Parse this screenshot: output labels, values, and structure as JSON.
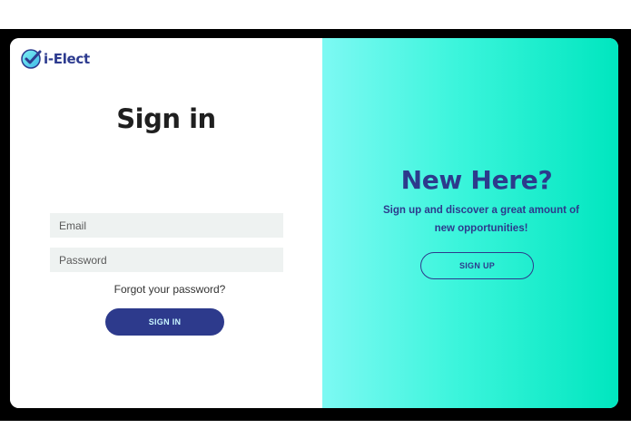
{
  "brand": {
    "name": "i-Elect",
    "logo_icon": "checkmark-circle-icon",
    "color": "#2d3b8f"
  },
  "signin": {
    "title": "Sign in",
    "email_placeholder": "Email",
    "password_placeholder": "Password",
    "forgot_label": "Forgot your password?",
    "button_label": "SIGN IN"
  },
  "promo": {
    "title": "New Here?",
    "text": "Sign up and discover a great amount of new opportunities!",
    "button_label": "SIGN UP"
  },
  "colors": {
    "accent": "#2d3a8c",
    "panel_gradient_start": "#7df9f3",
    "panel_gradient_end": "#00e6bf",
    "input_bg": "#eef2f1"
  }
}
